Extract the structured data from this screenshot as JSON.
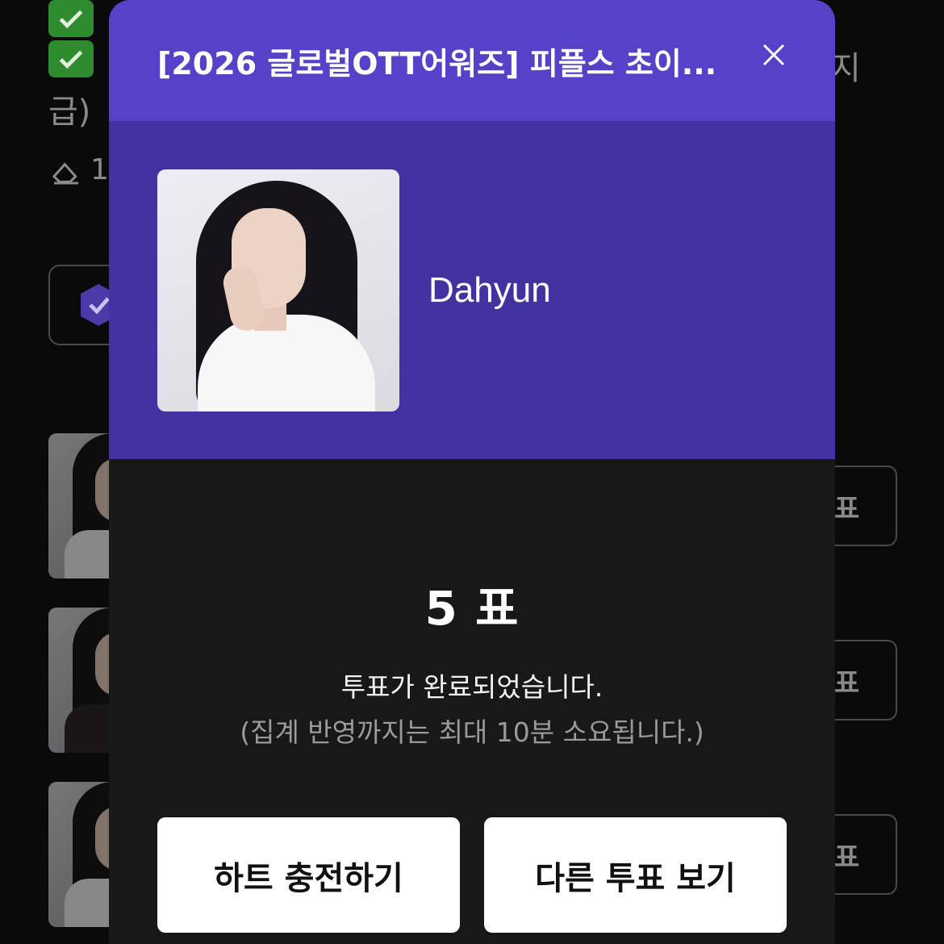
{
  "background": {
    "line3_start": "급)",
    "line2_end": "지",
    "count_prefix": "1",
    "vote_button_label": "표"
  },
  "modal": {
    "title": "[2026 글로벌OTT어워즈] 피플스 초이...",
    "close_icon": "close-icon",
    "candidate": {
      "name": "Dahyun"
    },
    "result": {
      "vote_count": "5 표",
      "message": "투표가 완료되었습니다.",
      "sub_message": "(집계 반영까지는 최대 10분 소요됩니다.)"
    },
    "buttons": {
      "charge_hearts": "하트 충전하기",
      "other_votes": "다른 투표 보기"
    }
  },
  "colors": {
    "header": "#5641c9",
    "candidate_panel": "#4333a0",
    "modal_body": "#181818",
    "check": "#2e8b2e"
  }
}
